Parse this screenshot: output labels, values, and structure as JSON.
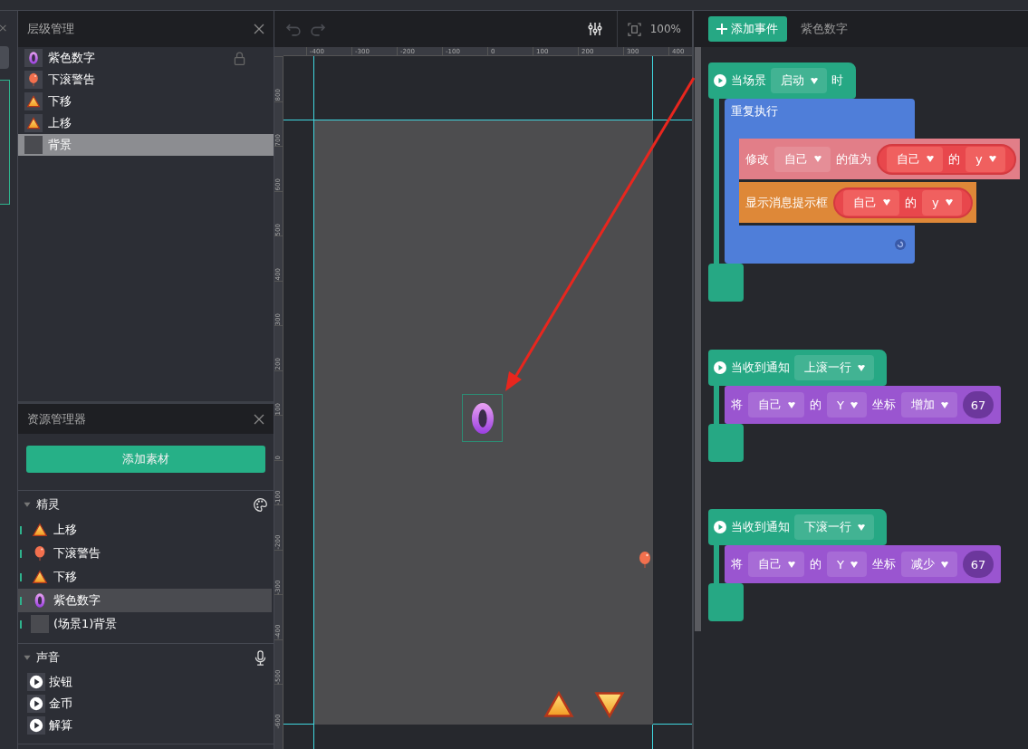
{
  "layers_panel": {
    "title": "层级管理",
    "items": [
      {
        "label": "紫色数字",
        "kind": "digit",
        "selected": false,
        "hovered": true
      },
      {
        "label": "下滚警告",
        "kind": "balloon",
        "selected": false,
        "hovered": false
      },
      {
        "label": "下移",
        "kind": "triangle",
        "selected": false,
        "hovered": false
      },
      {
        "label": "上移",
        "kind": "triangle",
        "selected": false,
        "hovered": false
      },
      {
        "label": "背景",
        "kind": "blank",
        "selected": true,
        "hovered": false
      }
    ]
  },
  "assets_panel": {
    "title": "资源管理器",
    "add_button": "添加素材",
    "sections": [
      {
        "title": "精灵",
        "expanded": true,
        "kind": "sprites",
        "items": [
          {
            "label": "上移",
            "kind": "triangle",
            "selected": false
          },
          {
            "label": "下滚警告",
            "kind": "balloon",
            "selected": false
          },
          {
            "label": "下移",
            "kind": "triangle",
            "selected": false
          },
          {
            "label": "紫色数字",
            "kind": "digit",
            "selected": true
          },
          {
            "label": "(场景1)背景",
            "kind": "blank",
            "selected": false
          }
        ]
      },
      {
        "title": "声音",
        "expanded": true,
        "kind": "sounds",
        "items": [
          {
            "label": "按钮",
            "kind": "sound",
            "selected": false
          },
          {
            "label": "金币",
            "kind": "sound",
            "selected": false
          },
          {
            "label": "解算",
            "kind": "sound",
            "selected": false
          }
        ]
      }
    ]
  },
  "stage_toolbar": {
    "undo_disabled": true,
    "redo_disabled": true,
    "zoom": "100%"
  },
  "rulers": {
    "x_labels": [
      "-400",
      "-300",
      "-200",
      "-100",
      "0",
      "100",
      "200",
      "300",
      "400"
    ],
    "y_labels": [
      "800",
      "700",
      "600",
      "500",
      "400",
      "300",
      "200",
      "100",
      "0",
      "-100",
      "-200",
      "-300",
      "-400",
      "-500",
      "-600"
    ]
  },
  "stage": {
    "sprites": [
      {
        "kind": "digit",
        "selected": true
      },
      {
        "kind": "balloon",
        "selected": false
      },
      {
        "kind": "triangle",
        "selected": false
      },
      {
        "kind": "triangle-down",
        "selected": false
      }
    ]
  },
  "script_panel": {
    "add_button": "添加事件",
    "target": "紫色数字",
    "scripts": [
      {
        "hat": [
          {
            "kind": "text",
            "text": "当场景"
          },
          {
            "kind": "dropdown",
            "text": "启动"
          },
          {
            "kind": "text",
            "text": "时"
          }
        ],
        "body": [
          {
            "kind": "repeat",
            "label": "重复执行",
            "body": [
              {
                "kind": "set",
                "parts": [
                  {
                    "kind": "text",
                    "text": "修改"
                  },
                  {
                    "kind": "dropdown",
                    "text": "自己"
                  },
                  {
                    "kind": "text",
                    "text": "的值为"
                  },
                  {
                    "kind": "reporter",
                    "parts": [
                      {
                        "kind": "dropdown",
                        "text": "自己"
                      },
                      {
                        "kind": "text",
                        "text": "的"
                      },
                      {
                        "kind": "dropdown",
                        "text": "y"
                      }
                    ]
                  }
                ]
              },
              {
                "kind": "toast",
                "parts": [
                  {
                    "kind": "text",
                    "text": "显示消息提示框"
                  },
                  {
                    "kind": "reporter",
                    "parts": [
                      {
                        "kind": "dropdown",
                        "text": "自己"
                      },
                      {
                        "kind": "text",
                        "text": "的"
                      },
                      {
                        "kind": "dropdown",
                        "text": "y"
                      }
                    ]
                  }
                ]
              }
            ]
          }
        ]
      },
      {
        "hat": [
          {
            "kind": "text",
            "text": "当收到通知"
          },
          {
            "kind": "dropdown",
            "text": "上滚一行"
          }
        ],
        "body": [
          {
            "kind": "move",
            "parts": [
              {
                "kind": "text",
                "text": "将"
              },
              {
                "kind": "dropdown",
                "text": "自己"
              },
              {
                "kind": "text",
                "text": "的"
              },
              {
                "kind": "dropdown",
                "text": "Y"
              },
              {
                "kind": "text",
                "text": "坐标"
              },
              {
                "kind": "dropdown",
                "text": "增加"
              },
              {
                "kind": "number",
                "text": "67"
              }
            ]
          }
        ]
      },
      {
        "hat": [
          {
            "kind": "text",
            "text": "当收到通知"
          },
          {
            "kind": "dropdown",
            "text": "下滚一行"
          }
        ],
        "body": [
          {
            "kind": "move",
            "parts": [
              {
                "kind": "text",
                "text": "将"
              },
              {
                "kind": "dropdown",
                "text": "自己"
              },
              {
                "kind": "text",
                "text": "的"
              },
              {
                "kind": "dropdown",
                "text": "Y"
              },
              {
                "kind": "text",
                "text": "坐标"
              },
              {
                "kind": "dropdown",
                "text": "减少"
              },
              {
                "kind": "number",
                "text": "67"
              }
            ]
          }
        ]
      }
    ]
  }
}
